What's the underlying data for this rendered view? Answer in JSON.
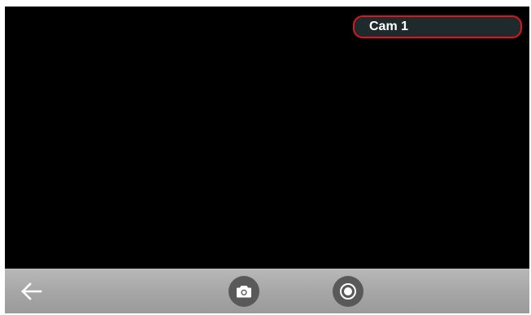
{
  "camera": {
    "label": "Cam 1",
    "label_border_color": "#e0141e"
  },
  "toolbar": {
    "back_icon": "arrow-left-icon",
    "snapshot_icon": "camera-icon",
    "record_icon": "record-icon"
  }
}
